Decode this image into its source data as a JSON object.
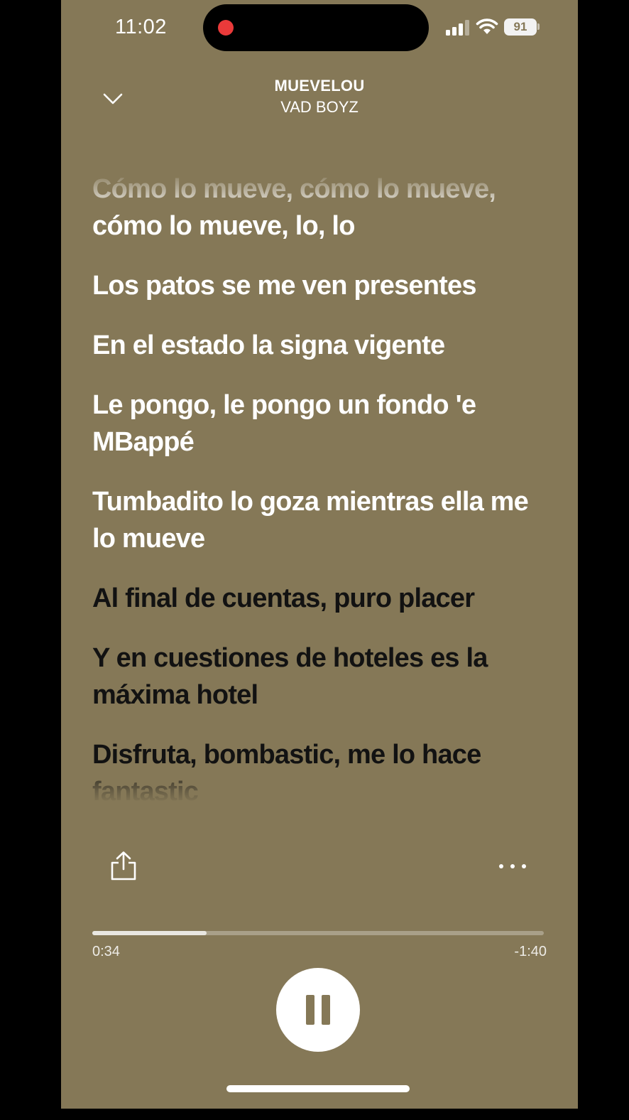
{
  "status_bar": {
    "time": "11:02",
    "battery": "91"
  },
  "header": {
    "title": "MUEVELOU",
    "artist": "VAD BOYZ"
  },
  "lyrics": [
    {
      "text": "Cómo lo mueve, cómo lo mueve, cómo lo mueve, lo, lo",
      "state": "past"
    },
    {
      "text": "Los patos se me ven presentes",
      "state": "past"
    },
    {
      "text": "En el estado la signa vigente",
      "state": "past"
    },
    {
      "text": "Le pongo, le pongo un fondo 'e MBappé",
      "state": "past"
    },
    {
      "text": "Tumbadito lo goza mientras ella me lo mueve",
      "state": "past"
    },
    {
      "text": "Al final de cuentas, puro placer",
      "state": "future"
    },
    {
      "text": "Y en cuestiones de hoteles es la máxima hotel",
      "state": "future"
    },
    {
      "text": "Disfruta, bombastic, me lo hace fantastic",
      "state": "future"
    }
  ],
  "player": {
    "elapsed": "0:34",
    "remaining": "-1:40",
    "progress_fraction": 0.253
  },
  "colors": {
    "background": "#857857",
    "past_lyric": "#ffffff",
    "future_lyric": "#121212",
    "recording_dot": "#ea3a3a"
  },
  "icons": {
    "collapse": "chevron-down-icon",
    "share": "share-icon",
    "more": "more-icon",
    "pause": "pause-icon"
  }
}
